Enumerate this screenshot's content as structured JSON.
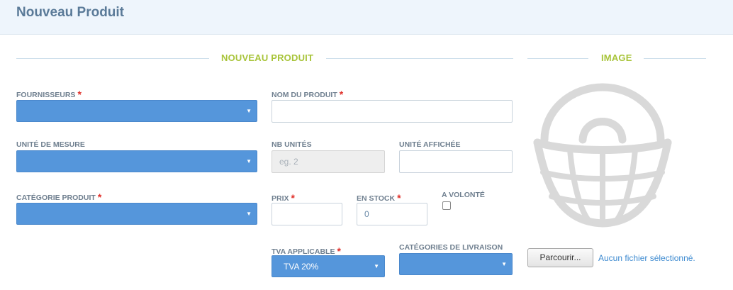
{
  "page": {
    "title": "Nouveau Produit"
  },
  "sections": {
    "product": "NOUVEAU PRODUIT",
    "image": "IMAGE"
  },
  "fields": {
    "fournisseurs": {
      "label": "FOURNISSEURS",
      "required": "*",
      "value": ""
    },
    "nom_produit": {
      "label": "NOM DU PRODUIT",
      "required": "*",
      "value": ""
    },
    "unite_mesure": {
      "label": "UNITÉ DE MESURE",
      "value": ""
    },
    "nb_unites": {
      "label": "NB UNITÉS",
      "placeholder": "eg. 2",
      "value": ""
    },
    "unite_affichee": {
      "label": "UNITÉ AFFICHÉE",
      "value": ""
    },
    "categorie_produit": {
      "label": "CATÉGORIE PRODUIT",
      "required": "*",
      "value": ""
    },
    "prix": {
      "label": "PRIX",
      "required": "*",
      "value": ""
    },
    "en_stock": {
      "label": "EN STOCK",
      "required": "*",
      "value": "0"
    },
    "a_volonte": {
      "label": "A VOLONTÉ",
      "checked": false
    },
    "tva": {
      "label": "TVA APPLICABLE",
      "required": "*",
      "value": "TVA 20%"
    },
    "categories_livraison": {
      "label": "CATÉGORIES DE LIVRAISON",
      "value": ""
    }
  },
  "image": {
    "placeholder_icon": "basket-icon",
    "browse_label": "Parcourir...",
    "file_status": "Aucun fichier sélectionné."
  },
  "colors": {
    "select_bg": "#5596db",
    "section_title": "#a8c43a",
    "required": "#e0302a",
    "header_bg": "#eef5fc"
  }
}
